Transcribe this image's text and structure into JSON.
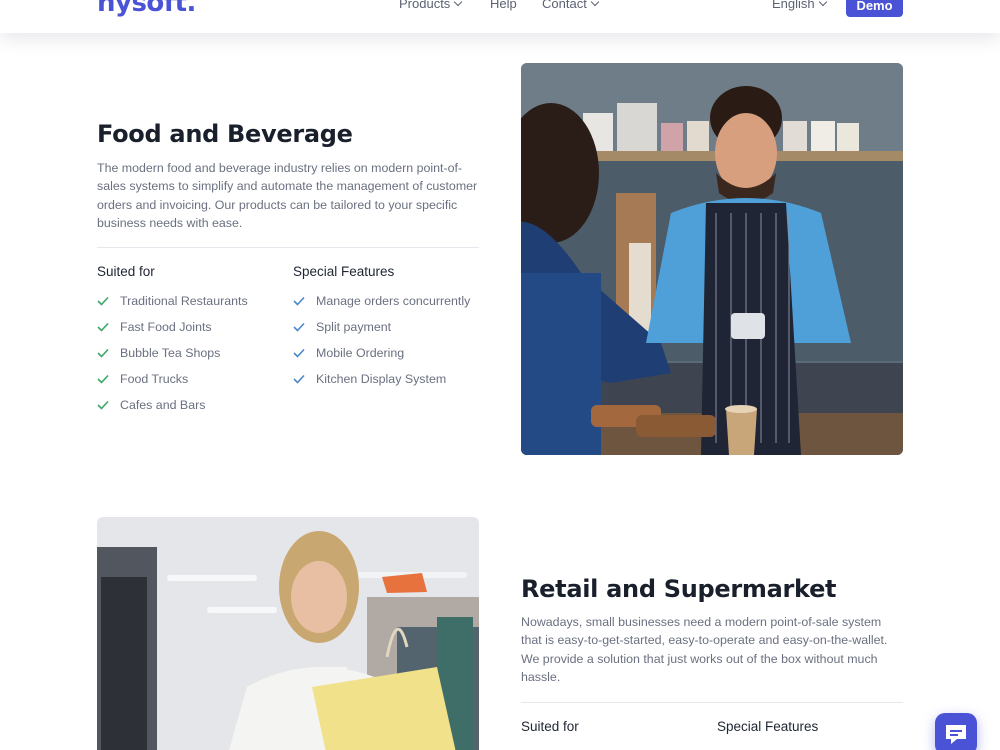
{
  "header": {
    "logo": "nysoft.",
    "nav": [
      "Products",
      "Help",
      "Contact"
    ],
    "language": "English",
    "demo_label": "Demo"
  },
  "food": {
    "title": "Food and Beverage",
    "description": "The modern food and beverage industry relies on modern point-of-sales systems to simplify and automate the management of customer orders and invoicing. Our products can be tailored to your specific business needs with ease.",
    "suited_title": "Suited for",
    "suited": [
      "Traditional Restaurants",
      "Fast Food Joints",
      "Bubble Tea Shops",
      "Food Trucks",
      "Cafes and Bars"
    ],
    "features_title": "Special Features",
    "features": [
      "Manage orders concurrently",
      "Split payment",
      "Mobile Ordering",
      "Kitchen Display System"
    ]
  },
  "retail": {
    "title": "Retail and Supermarket",
    "description": "Nowadays, small businesses need a modern point-of-sale system that is easy-to-get-started, easy-to-operate and easy-on-the-wallet. We provide a solution that just works out of the box without much hassle.",
    "suited_title": "Suited for",
    "features_title": "Special Features"
  },
  "icons": {
    "check": "check-icon",
    "chat": "chat-icon"
  },
  "colors": {
    "brand": "#4a53d6",
    "check": "#3aa866"
  }
}
